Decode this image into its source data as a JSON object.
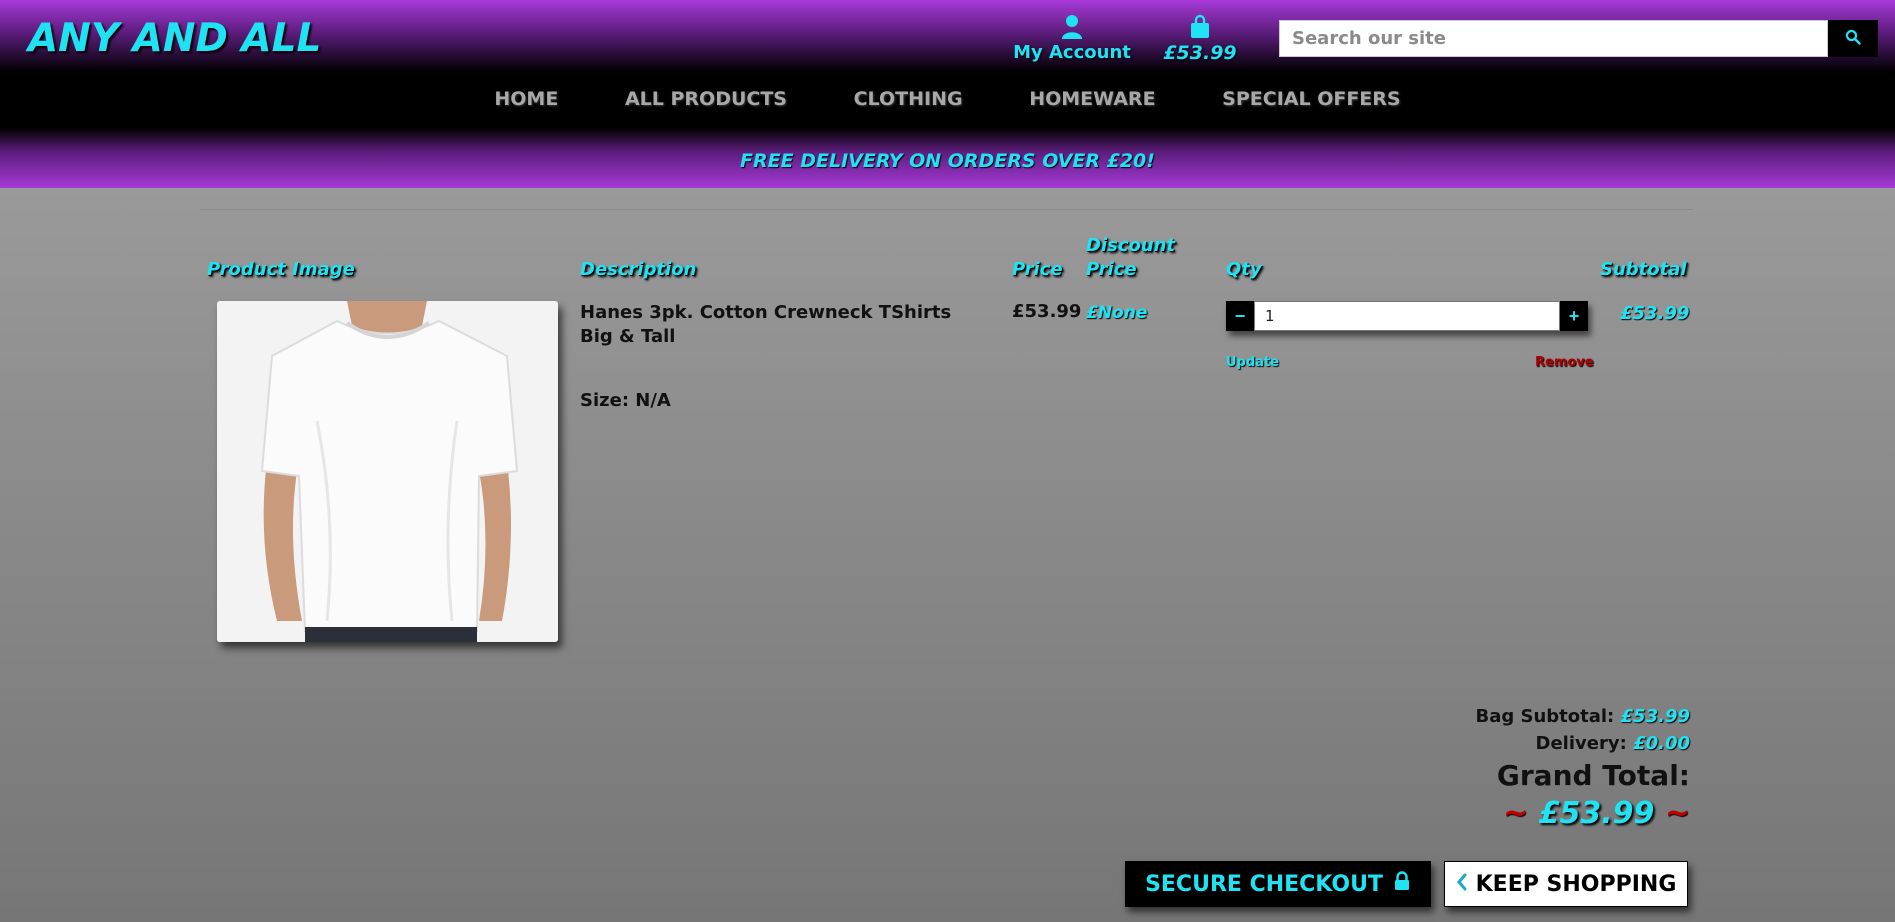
{
  "header": {
    "brand": "ANY AND ALL",
    "account_label": "My Account",
    "bag_total": "£53.99",
    "search_placeholder": "Search our site"
  },
  "nav": [
    "HOME",
    "ALL PRODUCTS",
    "CLOTHING",
    "HOMEWARE",
    "SPECIAL OFFERS"
  ],
  "promo": "FREE DELIVERY ON ORDERS OVER £20!",
  "table": {
    "headers": {
      "image": "Product Image",
      "description": "Description",
      "price": "Price",
      "discount_line1": "Discount",
      "discount_line2": "Price",
      "qty": "Qty",
      "subtotal": "Subtotal"
    },
    "rows": [
      {
        "description": "Hanes 3pk. Cotton Crewneck TShirts Big & Tall",
        "size": "Size: N/A",
        "price": "£53.99",
        "discount_price": "£None",
        "qty": "1",
        "subtotal": "£53.99",
        "update_label": "Update",
        "remove_label": "Remove",
        "decrement_label": "−",
        "increment_label": "+"
      }
    ]
  },
  "totals": {
    "bag_subtotal_label": "Bag Subtotal:",
    "bag_subtotal": "£53.99",
    "delivery_label": "Delivery:",
    "delivery": "£0.00",
    "grand_total_label": "Grand Total:",
    "grand_total": "£53.99",
    "tilde": "~"
  },
  "actions": {
    "checkout_label": "SECURE CHECKOUT",
    "keep_shopping_label": "KEEP SHOPPING"
  },
  "icons": {
    "account": "user-icon",
    "bag": "shopping-bag-icon",
    "search": "search-icon",
    "lock": "lock-icon",
    "back": "chevron-left-icon"
  },
  "colors": {
    "accent": "#1fe3f2",
    "purple": "#a63ad8",
    "danger": "#b30000"
  }
}
